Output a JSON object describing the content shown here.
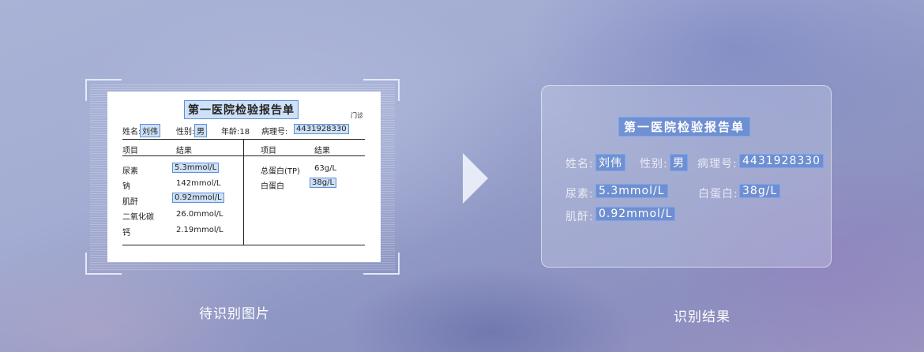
{
  "document": {
    "title": "第一医院检验报告单",
    "dept": "门诊",
    "name_label": "姓名:",
    "name_value": "刘伟",
    "gender_label": "性别:",
    "gender_value": "男",
    "age": "年龄:18",
    "record_label": "病理号:",
    "record_value": "4431928330",
    "headers": {
      "item1": "项目",
      "result1": "结果",
      "item2": "项目",
      "result2": "结果"
    },
    "left_rows": [
      {
        "item": "尿素",
        "result": "5.3mmol/L"
      },
      {
        "item": "钠",
        "result": "142mmol/L"
      },
      {
        "item": "肌酐",
        "result": "0.92mmol/L"
      },
      {
        "item": "二氧化碳",
        "result": "26.0mmol/L"
      },
      {
        "item": "钙",
        "result": "2.19mmol/L"
      }
    ],
    "right_rows": [
      {
        "item": "总蛋白(TP)",
        "result": "63g/L"
      },
      {
        "item": "白蛋白",
        "result": "38g/L"
      }
    ]
  },
  "captions": {
    "left": "待识别图片",
    "right": "识别结果"
  },
  "result": {
    "title": "第一医院检验报告单",
    "name_label": "姓名:",
    "name_value": "刘伟",
    "gender_label": "性别:",
    "gender_value": "男",
    "record_label": "病理号:",
    "record_value": "4431928330",
    "urea_label": "尿素:",
    "urea_value": "5.3mmol/L",
    "albumin_label": "白蛋白:",
    "albumin_value": "38g/L",
    "creatinine_label": "肌酐:",
    "creatinine_value": "0.92mmol/L"
  },
  "colors": {
    "highlight_fill": "#cfe1f7",
    "highlight_border": "#5b8fd6",
    "card_value_fill": "#4678d2"
  }
}
